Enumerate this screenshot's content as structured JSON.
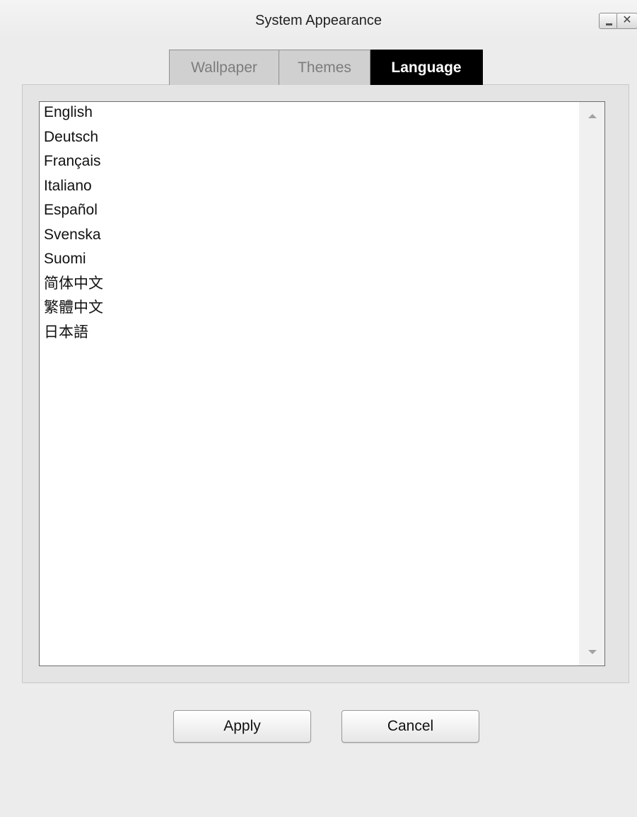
{
  "window": {
    "title": "System Appearance"
  },
  "tabs": [
    {
      "label": "Wallpaper",
      "selected": false
    },
    {
      "label": "Themes",
      "selected": false
    },
    {
      "label": "Language",
      "selected": true
    }
  ],
  "languages": [
    "English",
    "Deutsch",
    "Français",
    "Italiano",
    "Español",
    "Svenska",
    "Suomi",
    "简体中文",
    "繁體中文",
    "日本語"
  ],
  "buttons": {
    "apply": "Apply",
    "cancel": "Cancel"
  }
}
